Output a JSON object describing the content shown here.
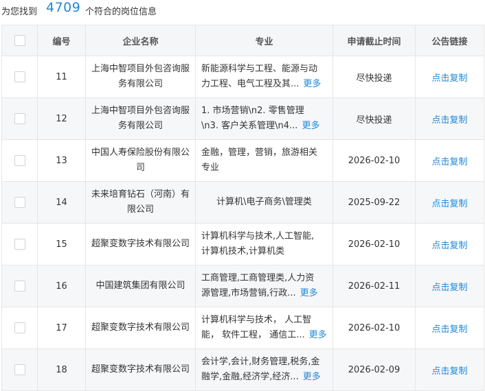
{
  "summary": {
    "prefix": "为您找到",
    "count": "4709",
    "suffix": "个符合的岗位信息"
  },
  "columns": {
    "num": "编号",
    "company": "企业名称",
    "major": "专业",
    "deadline": "申请截止时间",
    "link": "公告链接"
  },
  "more_label": "更多",
  "rows": [
    {
      "num": "11",
      "company": "上海中智项目外包咨询服务有限公司",
      "major_l1": "新能源科学与工程、能源与动",
      "major_l2": "力工程、电气工程及其...",
      "has_more": true,
      "deadline": "尽快投递",
      "link": "点击复制"
    },
    {
      "num": "12",
      "company": "上海中智项目外包咨询服务有限公司",
      "major_l1": "1. 市场营销\\n2. 零售管理",
      "major_l2": "\\n3. 客户关系管理\\n4...",
      "has_more": true,
      "deadline": "尽快投递",
      "link": "点击复制"
    },
    {
      "num": "13",
      "company": "中国人寿保险股份有限公司",
      "major_l1": "金融，管理，营销，旅游相关",
      "major_l2": "专业",
      "has_more": false,
      "deadline": "2026-02-10",
      "link": "点击复制"
    },
    {
      "num": "14",
      "company": "未来培育钻石（河南）有限公司",
      "major_l1": "计算机\\电子商务\\管理类",
      "major_l2": "",
      "has_more": false,
      "deadline": "2025-09-22",
      "link": "点击复制"
    },
    {
      "num": "15",
      "company": "超聚变数字技术有限公司",
      "major_l1": "计算机科学与技术,人工智能,",
      "major_l2": "计算机技术,计算机类",
      "has_more": false,
      "deadline": "2026-02-10",
      "link": "点击复制"
    },
    {
      "num": "16",
      "company": "中国建筑集团有限公司",
      "major_l1": "工商管理,工商管理类,人力资",
      "major_l2": "源管理,市场营销,行政...",
      "has_more": true,
      "deadline": "2026-02-11",
      "link": "点击复制"
    },
    {
      "num": "17",
      "company": "超聚变数字技术有限公司",
      "major_l1": "计算机科学与技术， 人工智",
      "major_l2": "能， 软件工程， 通信工...",
      "has_more": true,
      "deadline": "2026-02-10",
      "link": "点击复制"
    },
    {
      "num": "18",
      "company": "超聚变数字技术有限公司",
      "major_l1": "会计学,会计,财务管理,税务,金",
      "major_l2": "融学,金融,经济学,经济...",
      "has_more": true,
      "deadline": "2026-02-09",
      "link": "点击复制"
    }
  ]
}
